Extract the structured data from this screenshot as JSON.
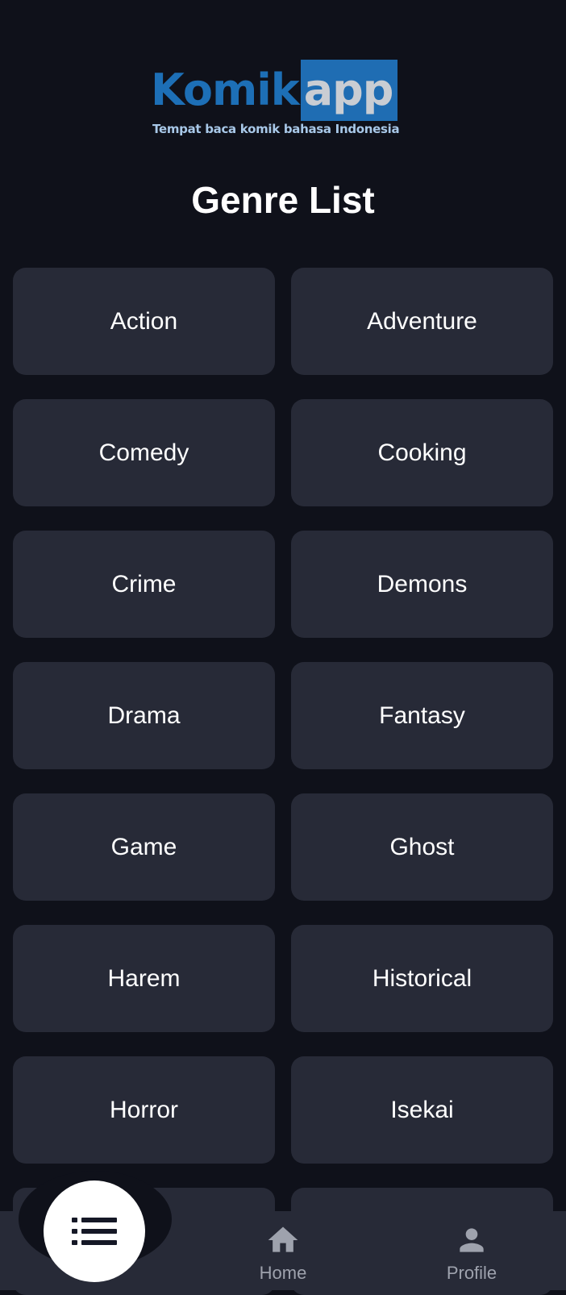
{
  "logo": {
    "brand_part1": "Komik",
    "brand_part2": "app",
    "tagline": "Tempat baca komik bahasa Indonesia"
  },
  "page_title": "Genre List",
  "genres": [
    "Action",
    "Adventure",
    "Comedy",
    "Cooking",
    "Crime",
    "Demons",
    "Drama",
    "Fantasy",
    "Game",
    "Ghost",
    "Harem",
    "Historical",
    "Horror",
    "Isekai",
    "",
    ""
  ],
  "bottom_nav": {
    "fab_icon": "list-icon",
    "items": [
      {
        "label": "Home",
        "icon": "home-icon"
      },
      {
        "label": "Profile",
        "icon": "person-icon"
      }
    ]
  },
  "colors": {
    "background": "#0f111a",
    "card": "#272a37",
    "nav_bar": "#272a37",
    "nav_label": "#9ea2ad",
    "logo_blue": "#1d6fb6"
  }
}
